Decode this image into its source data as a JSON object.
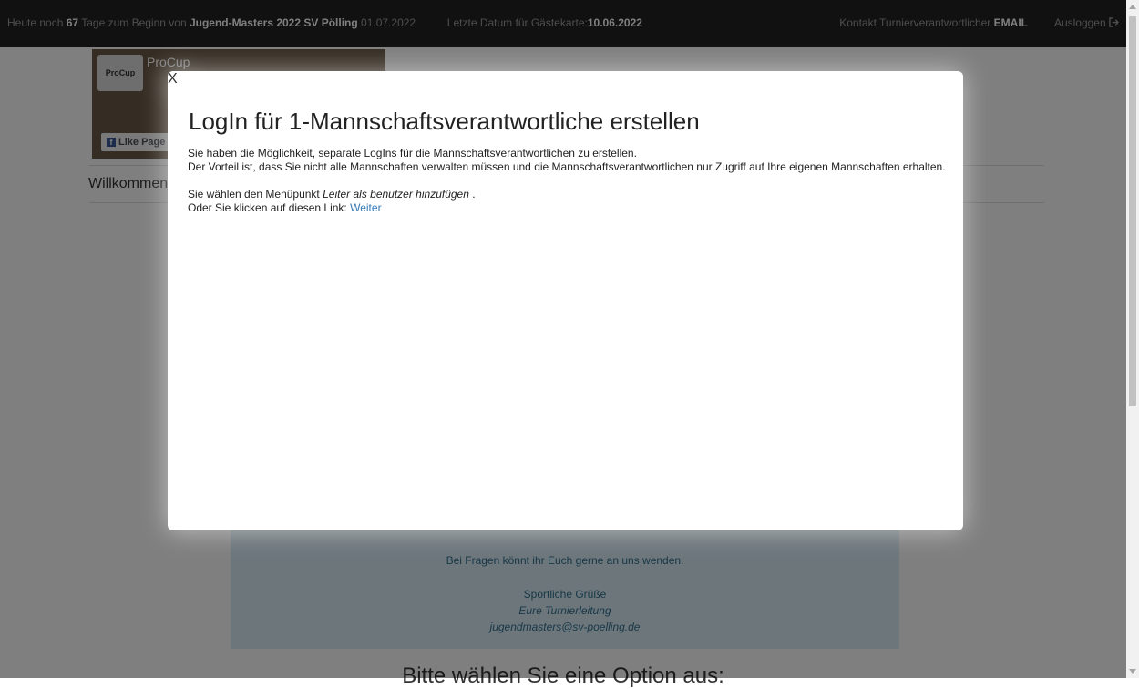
{
  "navbar": {
    "countdown_prefix": "Heute noch",
    "days": "67",
    "countdown_mid": "Tage zum Beginn von",
    "event_name": "Jugend-Masters 2022 SV Pölling",
    "event_date": "01.07.2022",
    "guest_card_label": "Letzte Datum für Gästekarte:",
    "guest_card_date": "10.06.2022",
    "contact_label": "Kontakt Turnierverantwortlicher",
    "contact_link": "EMAIL",
    "logout_label": "Ausloggen",
    "logout_icon": "logout-icon"
  },
  "facebook_widget": {
    "page_name": "ProCup",
    "logo_text": "ProCup",
    "like_label": "Like Page"
  },
  "page": {
    "welcome": "Willkommen",
    "info_box": {
      "question": "Bei Fragen könnt ihr Euch gerne an uns wenden.",
      "greeting": "Sportliche Grüße",
      "team": "Eure Turnierleitung",
      "email": "jugendmasters@sv-poelling.de"
    },
    "choose_option": "Bitte wählen Sie eine Option aus:"
  },
  "modal": {
    "close_label": "X",
    "title": "LogIn für 1-Mannschaftsverantwortliche erstellen",
    "line1": "Sie haben die Möglichkeit, separate LogIns für die Mannschaftsverantwortlichen zu erstellen.",
    "line2": "Der Vorteil ist, dass Sie nicht alle Mannschaften verwalten müssen und die Mannschaftsverantwortlichen nur Zugriff auf Ihre eigenen Mannschaften erhalten.",
    "menu_prefix": "Sie wählen den Menüpunkt",
    "menu_item": "Leiter als benutzer hinzufügen",
    "menu_suffix": ".",
    "link_prefix": "Oder Sie klicken auf diesen Link:",
    "link_label": "Weiter"
  }
}
